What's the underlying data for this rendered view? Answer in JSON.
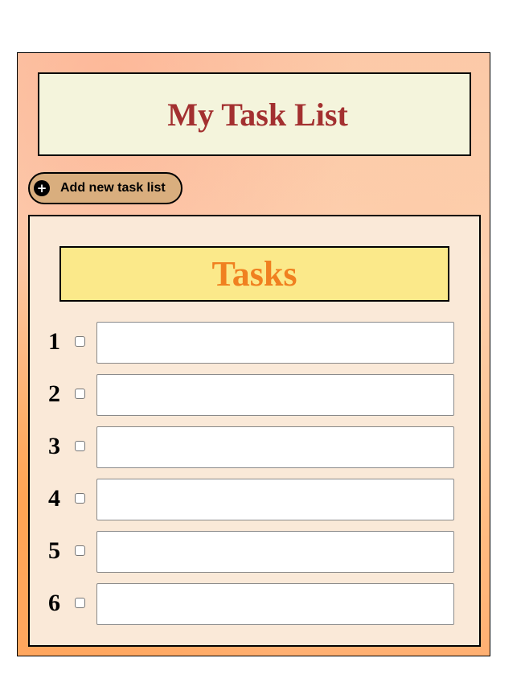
{
  "app": {
    "title": "My Task List",
    "add_button_label": "Add new task list",
    "add_button_icon": "plus-circle-icon"
  },
  "tasks_panel": {
    "heading": "Tasks",
    "rows": [
      {
        "number": "1",
        "checked": false,
        "value": ""
      },
      {
        "number": "2",
        "checked": false,
        "value": ""
      },
      {
        "number": "3",
        "checked": false,
        "value": ""
      },
      {
        "number": "4",
        "checked": false,
        "value": ""
      },
      {
        "number": "5",
        "checked": false,
        "value": ""
      },
      {
        "number": "6",
        "checked": false,
        "value": ""
      }
    ]
  },
  "colors": {
    "title_text": "#a33030",
    "title_bg": "#f4f4dc",
    "button_bg": "#d9ae7e",
    "tasks_heading_text": "#f08020",
    "tasks_heading_bg": "#fbe98a",
    "panel_bg": "#fae9d8"
  }
}
